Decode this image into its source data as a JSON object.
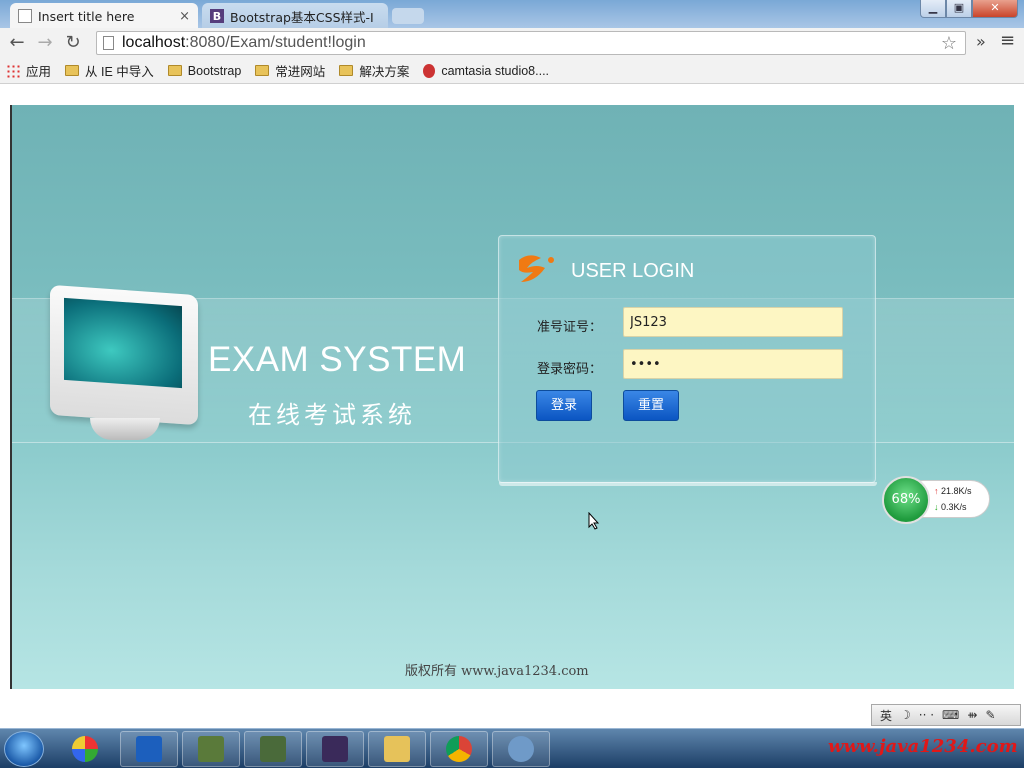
{
  "browser": {
    "tabs": [
      {
        "title": "Insert title here",
        "active": true
      },
      {
        "title": "Bootstrap基本CSS样式-I",
        "active": false
      }
    ],
    "close_glyph": "×",
    "window_controls": {
      "minimize": "▁",
      "maximize": "▣",
      "close": "✕"
    },
    "nav": {
      "back": "←",
      "forward": "→",
      "reload": "↻"
    },
    "url_host": "localhost",
    "url_rest": ":8080/Exam/student!login",
    "star": "☆",
    "more": "»",
    "menu": "≡"
  },
  "bookmarks": [
    {
      "label": "应用",
      "icon": "apps-grid-icon"
    },
    {
      "label": "从 IE 中导入",
      "icon": "folder-icon"
    },
    {
      "label": "Bootstrap",
      "icon": "folder-icon"
    },
    {
      "label": "常进网站",
      "icon": "folder-icon"
    },
    {
      "label": "解决方案",
      "icon": "folder-icon"
    },
    {
      "label": "camtasia studio8....",
      "icon": "camtasia-icon"
    }
  ],
  "page": {
    "exam_title": "EXAM SYSTEM",
    "exam_subtitle": "在线考试系统",
    "login": {
      "title": "USER LOGIN",
      "ticket_label": "准号证号：",
      "ticket_value": "JS123",
      "password_label": "登录密码：",
      "password_value": "1234",
      "login_button": "登录",
      "reset_button": "重置"
    },
    "copyright": "版权所有 www.java1234.com"
  },
  "speed_widget": {
    "percent": "68%",
    "up_arrow": "↑",
    "down_arrow": "↓",
    "up": "21.8K/s",
    "down": "0.3K/s"
  },
  "ime": {
    "lang": "英",
    "moon": "☽",
    "dots": "·· ·",
    "keyboard": "⌨",
    "arrows": "⇻",
    "wrench": "✎"
  },
  "taskbar": {
    "apps": [
      "start-orb",
      "media-player",
      "wps-writer",
      "app-3",
      "app-4",
      "eclipse-java-ee",
      "file-explorer",
      "chrome",
      "dolphin-app"
    ],
    "watermark": "www.java1234.com"
  },
  "colors": {
    "stage_top": "#6fb2b5",
    "stage_bottom": "#b6e5e4",
    "input_bg": "#fdf6c3",
    "button_blue": "#0b55c2",
    "watermark_red": "#e01818"
  }
}
